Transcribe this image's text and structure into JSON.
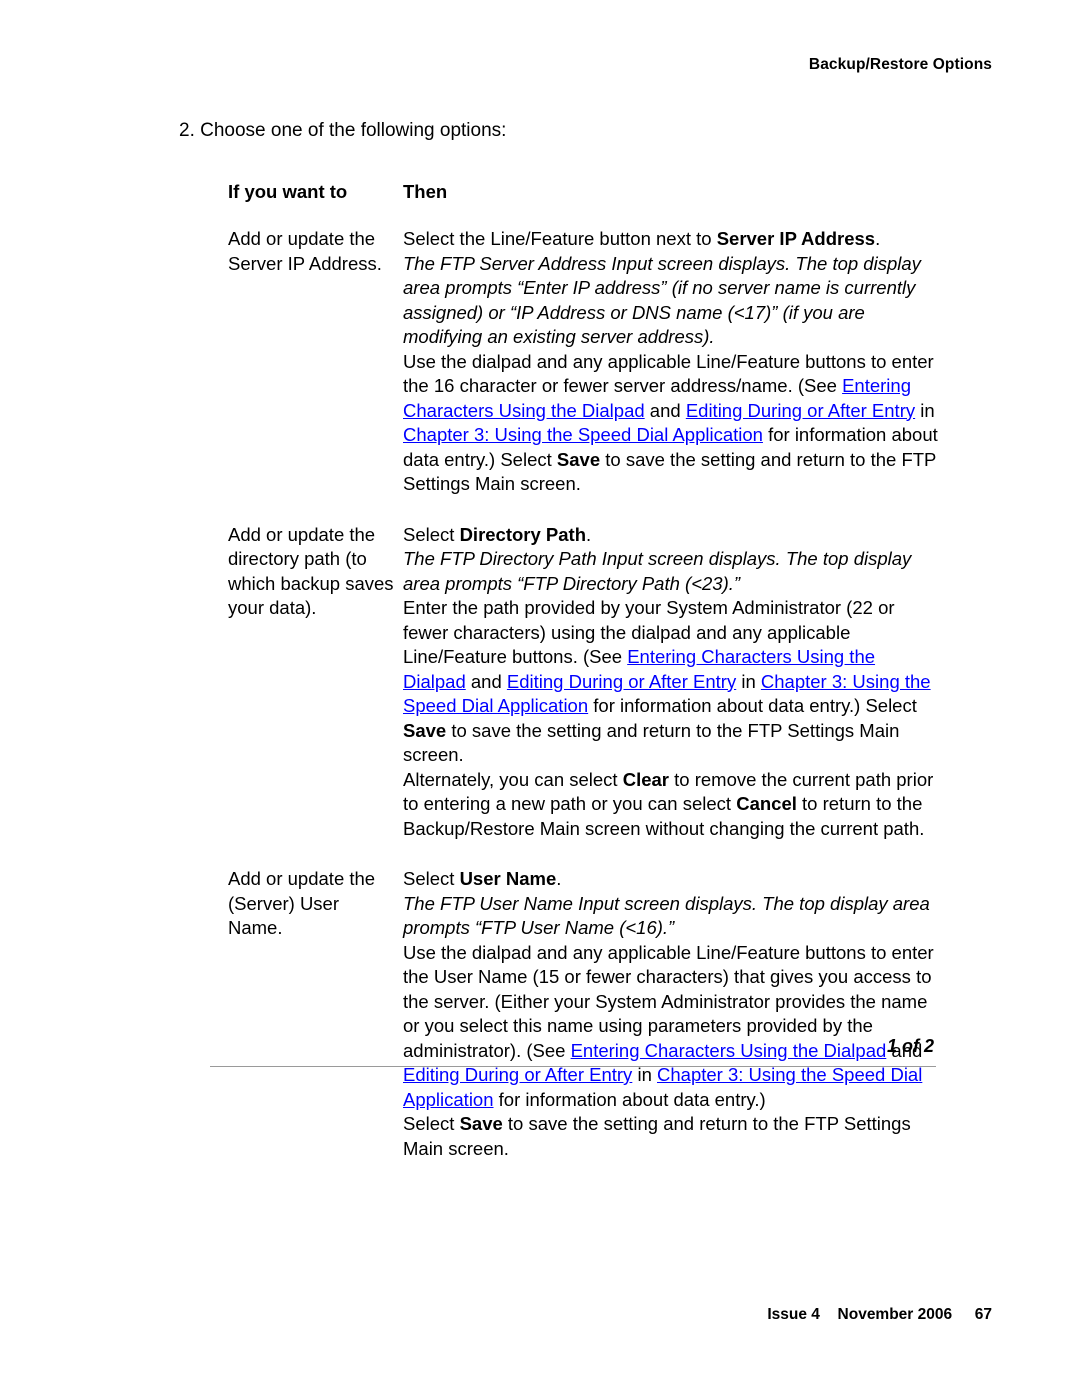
{
  "header": {
    "running_title": "Backup/Restore Options"
  },
  "step": {
    "text": "2. Choose one of the following options:"
  },
  "table": {
    "columns": {
      "if_you_want_to": "If you want to",
      "then": "Then"
    },
    "rows": [
      {
        "if_text": "Add or update the Server IP Address.",
        "then_paragraphs": [
          {
            "style": "normal",
            "runs": [
              {
                "text": "Select the Line/Feature button next to ",
                "style": "normal"
              },
              {
                "text": "Server IP Address",
                "style": "bold"
              },
              {
                "text": ".",
                "style": "normal"
              }
            ]
          },
          {
            "style": "italic",
            "runs": [
              {
                "text": "The FTP Server Address Input screen displays. The top display area prompts “Enter IP address” (if no server name is currently assigned) or “IP Address or DNS name (<17)” (if you are modifying an existing server address).",
                "style": "normal"
              }
            ]
          },
          {
            "style": "normal",
            "runs": [
              {
                "text": "Use the dialpad and any applicable Line/Feature buttons to enter the 16 character or fewer server address/name. (See ",
                "style": "normal"
              },
              {
                "text": "Entering Characters Using the Dialpad",
                "style": "link"
              },
              {
                "text": " and ",
                "style": "normal"
              },
              {
                "text": "Editing During or After Entry",
                "style": "link"
              },
              {
                "text": " in ",
                "style": "normal"
              },
              {
                "text": "Chapter 3: Using the Speed Dial Application",
                "style": "link"
              },
              {
                "text": " for information about data entry.) Select ",
                "style": "normal"
              },
              {
                "text": "Save",
                "style": "bold"
              },
              {
                "text": " to save the setting and return to the FTP Settings Main screen.",
                "style": "normal"
              }
            ]
          }
        ]
      },
      {
        "if_text": "Add or update the directory path (to which backup saves your data).",
        "then_paragraphs": [
          {
            "style": "normal",
            "runs": [
              {
                "text": "Select ",
                "style": "normal"
              },
              {
                "text": "Directory Path",
                "style": "bold"
              },
              {
                "text": ".",
                "style": "normal"
              }
            ]
          },
          {
            "style": "italic",
            "runs": [
              {
                "text": "The FTP Directory Path Input screen displays. The top display area prompts “FTP Directory Path (<23).”",
                "style": "normal"
              }
            ]
          },
          {
            "style": "normal",
            "runs": [
              {
                "text": "Enter the path provided by your System Administrator (22 or fewer characters) using the dialpad and any applicable Line/Feature buttons. (See ",
                "style": "normal"
              },
              {
                "text": "Entering Characters Using the Dialpad",
                "style": "link"
              },
              {
                "text": " and ",
                "style": "normal"
              },
              {
                "text": "Editing During or After Entry",
                "style": "link"
              },
              {
                "text": " in ",
                "style": "normal"
              },
              {
                "text": "Chapter 3: Using the Speed Dial Application",
                "style": "link"
              },
              {
                "text": " for information about data entry.) Select ",
                "style": "normal"
              },
              {
                "text": "Save",
                "style": "bold"
              },
              {
                "text": " to save the setting and return to the FTP Settings Main screen.",
                "style": "normal"
              }
            ]
          },
          {
            "style": "normal",
            "runs": [
              {
                "text": "Alternately, you can select ",
                "style": "normal"
              },
              {
                "text": "Clear",
                "style": "bold"
              },
              {
                "text": " to remove the current path prior to entering a new path or you can select ",
                "style": "normal"
              },
              {
                "text": "Cancel",
                "style": "bold"
              },
              {
                "text": " to return to the Backup/Restore Main screen without changing the current path.",
                "style": "normal"
              }
            ]
          }
        ]
      },
      {
        "if_text": "Add or update the (Server) User Name.",
        "then_paragraphs": [
          {
            "style": "normal",
            "runs": [
              {
                "text": "Select ",
                "style": "normal"
              },
              {
                "text": "User Name",
                "style": "bold"
              },
              {
                "text": ".",
                "style": "normal"
              }
            ]
          },
          {
            "style": "italic",
            "runs": [
              {
                "text": "The FTP User Name Input screen displays. The top display area prompts “FTP User Name (<16).”",
                "style": "normal"
              }
            ]
          },
          {
            "style": "normal",
            "runs": [
              {
                "text": "Use the dialpad and any applicable Line/Feature buttons to enter the User Name (15 or fewer characters) that gives you access to the server. (Either your System Administrator provides the name or you select this name using parameters provided by the administrator). (See ",
                "style": "normal"
              },
              {
                "text": "Entering Characters Using the Dialpad",
                "style": "link"
              },
              {
                "text": " and ",
                "style": "normal"
              },
              {
                "text": "Editing During or After Entry",
                "style": "link"
              },
              {
                "text": " in ",
                "style": "normal"
              },
              {
                "text": "Chapter 3: Using the Speed Dial Application",
                "style": "link"
              },
              {
                "text": " for information about data entry.)",
                "style": "normal"
              }
            ]
          },
          {
            "style": "normal",
            "runs": [
              {
                "text": "Select ",
                "style": "normal"
              },
              {
                "text": "Save",
                "style": "bold"
              },
              {
                "text": " to save the setting and return to the FTP Settings Main screen.",
                "style": "normal"
              }
            ]
          }
        ]
      }
    ],
    "sheet_count": "1 of 2"
  },
  "footer": {
    "issue": "Issue 4",
    "date": "November 2006",
    "page_number": "67"
  },
  "colors": {
    "link": "#0000ff",
    "text": "#000000",
    "rule": "#9a9a9a"
  }
}
